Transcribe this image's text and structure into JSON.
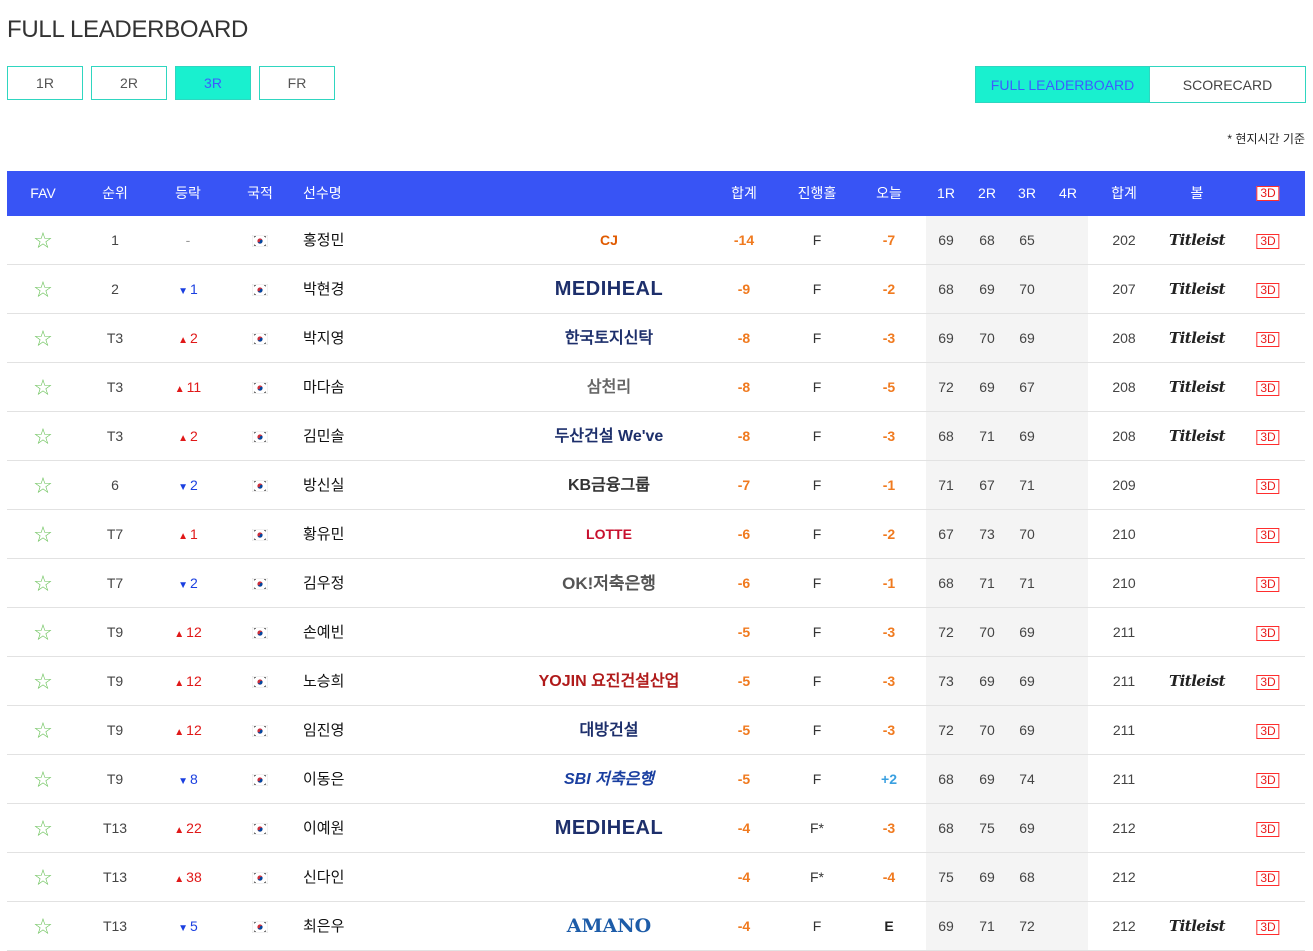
{
  "title": "FULL LEADERBOARD",
  "round_tabs": [
    {
      "label": "1R",
      "active": false
    },
    {
      "label": "2R",
      "active": false
    },
    {
      "label": "3R",
      "active": true
    },
    {
      "label": "FR",
      "active": false
    }
  ],
  "view_tabs": [
    {
      "label": "FULL LEADERBOARD",
      "active": true
    },
    {
      "label": "SCORECARD",
      "active": false
    }
  ],
  "note": "* 현지시간 기준",
  "headers": {
    "fav": "FAV",
    "rank": "순위",
    "move": "등락",
    "nation": "국적",
    "name": "선수명",
    "total": "합계",
    "hole": "진행홀",
    "today": "오늘",
    "r1": "1R",
    "r2": "2R",
    "r3": "3R",
    "r4": "4R",
    "sum": "합계",
    "ball": "볼",
    "view3d": "3D"
  },
  "colors": {
    "header_bg": "#3854f5",
    "tab_accent": "#19f0cf",
    "score_orange": "#f07a1f",
    "move_up": "#e01818",
    "move_down": "#1a3fe0"
  },
  "icons": {
    "fav": "star-outline-icon",
    "nation": "korea-flag-icon"
  },
  "rows": [
    {
      "rank": "1",
      "move": "-",
      "dir": "none",
      "name": "홍정민",
      "sponsor": "CJ",
      "total": "-14",
      "hole": "F",
      "today": "-7",
      "r1": "69",
      "r2": "68",
      "r3": "65",
      "sum": "202",
      "ball": "Titleist"
    },
    {
      "rank": "2",
      "move": "1",
      "dir": "down",
      "name": "박현경",
      "sponsor": "MEDIHEAL",
      "total": "-9",
      "hole": "F",
      "today": "-2",
      "r1": "68",
      "r2": "69",
      "r3": "70",
      "sum": "207",
      "ball": "Titleist"
    },
    {
      "rank": "T3",
      "move": "2",
      "dir": "up",
      "name": "박지영",
      "sponsor": "한국토지신탁",
      "total": "-8",
      "hole": "F",
      "today": "-3",
      "r1": "69",
      "r2": "70",
      "r3": "69",
      "sum": "208",
      "ball": "Titleist"
    },
    {
      "rank": "T3",
      "move": "11",
      "dir": "up",
      "name": "마다솜",
      "sponsor": "삼천리",
      "total": "-8",
      "hole": "F",
      "today": "-5",
      "r1": "72",
      "r2": "69",
      "r3": "67",
      "sum": "208",
      "ball": "Titleist"
    },
    {
      "rank": "T3",
      "move": "2",
      "dir": "up",
      "name": "김민솔",
      "sponsor": "두산건설 We've",
      "total": "-8",
      "hole": "F",
      "today": "-3",
      "r1": "68",
      "r2": "71",
      "r3": "69",
      "sum": "208",
      "ball": "Titleist"
    },
    {
      "rank": "6",
      "move": "2",
      "dir": "down",
      "name": "방신실",
      "sponsor": "KB금융그룹",
      "total": "-7",
      "hole": "F",
      "today": "-1",
      "r1": "71",
      "r2": "67",
      "r3": "71",
      "sum": "209",
      "ball": ""
    },
    {
      "rank": "T7",
      "move": "1",
      "dir": "up",
      "name": "황유민",
      "sponsor": "LOTTE",
      "total": "-6",
      "hole": "F",
      "today": "-2",
      "r1": "67",
      "r2": "73",
      "r3": "70",
      "sum": "210",
      "ball": ""
    },
    {
      "rank": "T7",
      "move": "2",
      "dir": "down",
      "name": "김우정",
      "sponsor": "OK!저축은행",
      "total": "-6",
      "hole": "F",
      "today": "-1",
      "r1": "68",
      "r2": "71",
      "r3": "71",
      "sum": "210",
      "ball": ""
    },
    {
      "rank": "T9",
      "move": "12",
      "dir": "up",
      "name": "손예빈",
      "sponsor": "",
      "total": "-5",
      "hole": "F",
      "today": "-3",
      "r1": "72",
      "r2": "70",
      "r3": "69",
      "sum": "211",
      "ball": ""
    },
    {
      "rank": "T9",
      "move": "12",
      "dir": "up",
      "name": "노승희",
      "sponsor": "YOJIN 요진건설산업",
      "total": "-5",
      "hole": "F",
      "today": "-3",
      "r1": "73",
      "r2": "69",
      "r3": "69",
      "sum": "211",
      "ball": "Titleist"
    },
    {
      "rank": "T9",
      "move": "12",
      "dir": "up",
      "name": "임진영",
      "sponsor": "대방건설",
      "total": "-5",
      "hole": "F",
      "today": "-3",
      "r1": "72",
      "r2": "70",
      "r3": "69",
      "sum": "211",
      "ball": ""
    },
    {
      "rank": "T9",
      "move": "8",
      "dir": "down",
      "name": "이동은",
      "sponsor": "SBI 저축은행",
      "total": "-5",
      "hole": "F",
      "today": "+2",
      "r1": "68",
      "r2": "69",
      "r3": "74",
      "sum": "211",
      "ball": ""
    },
    {
      "rank": "T13",
      "move": "22",
      "dir": "up",
      "name": "이예원",
      "sponsor": "MEDIHEAL",
      "total": "-4",
      "hole": "F*",
      "today": "-3",
      "r1": "68",
      "r2": "75",
      "r3": "69",
      "sum": "212",
      "ball": ""
    },
    {
      "rank": "T13",
      "move": "38",
      "dir": "up",
      "name": "신다인",
      "sponsor": "",
      "total": "-4",
      "hole": "F*",
      "today": "-4",
      "r1": "75",
      "r2": "69",
      "r3": "68",
      "sum": "212",
      "ball": ""
    },
    {
      "rank": "T13",
      "move": "5",
      "dir": "down",
      "name": "최은우",
      "sponsor": "AMANO",
      "total": "-4",
      "hole": "F",
      "today": "E",
      "r1": "69",
      "r2": "71",
      "r3": "72",
      "sum": "212",
      "ball": "Titleist"
    }
  ]
}
